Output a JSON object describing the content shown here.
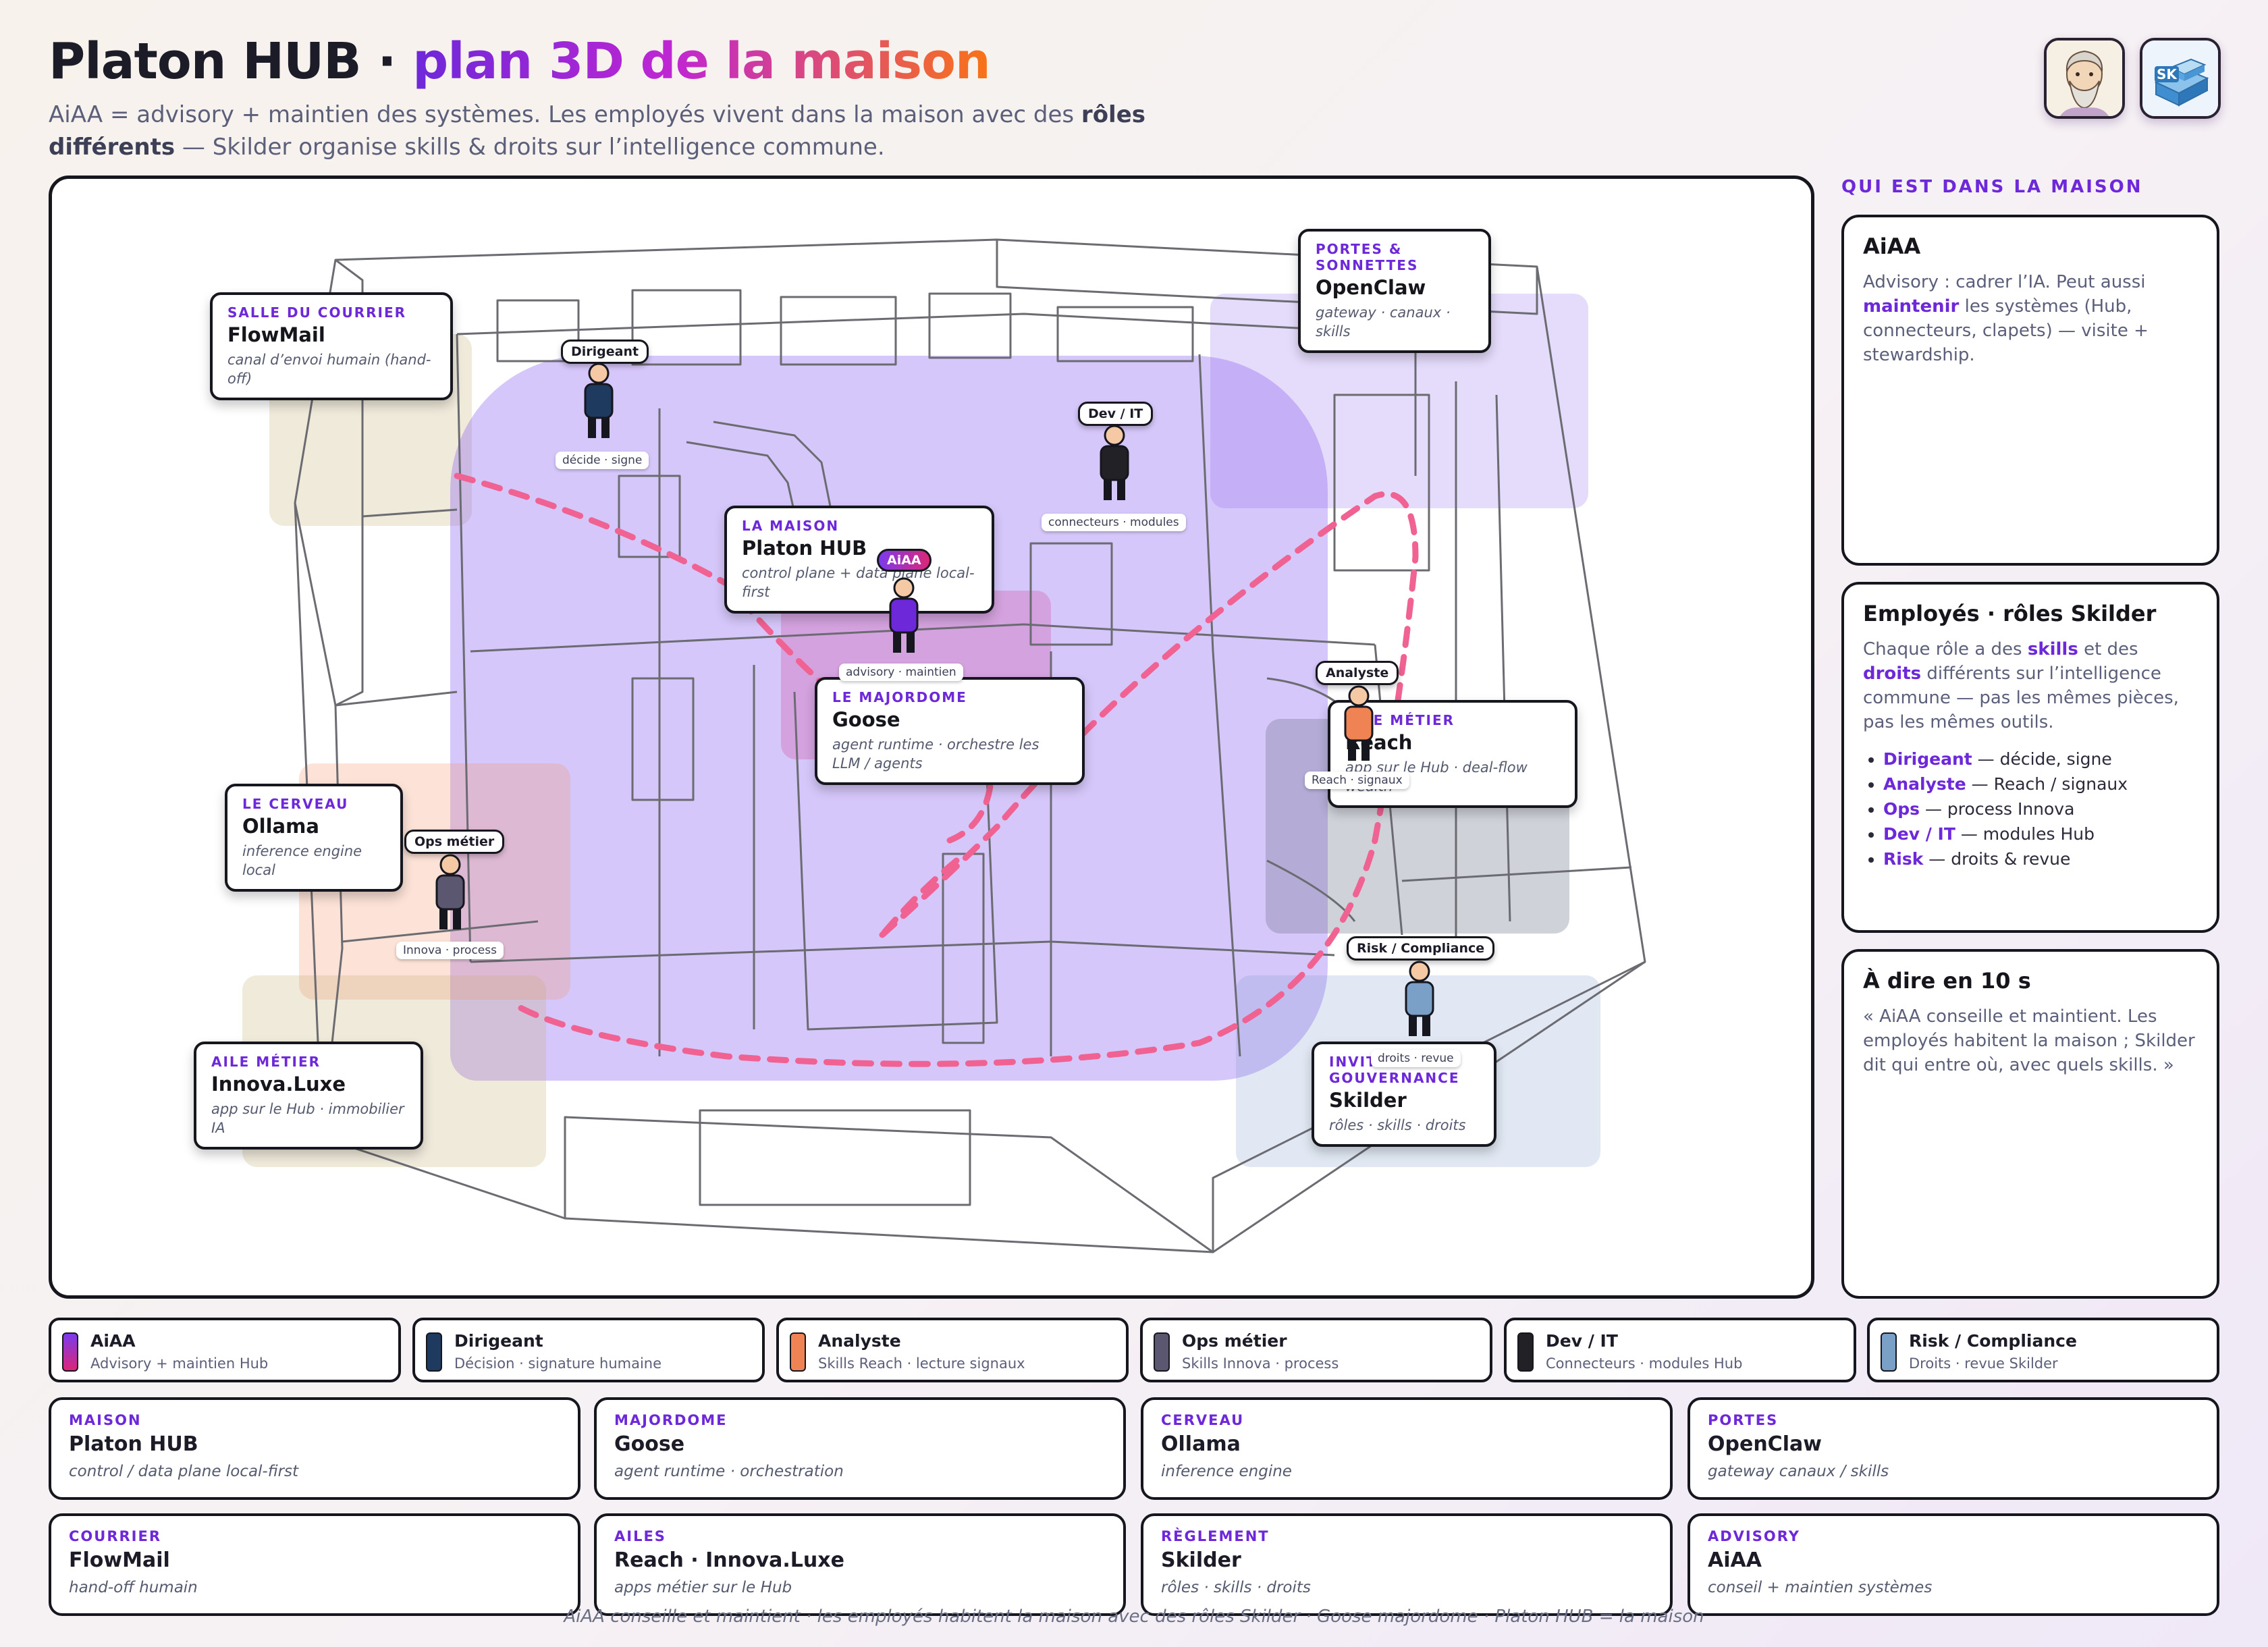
{
  "header": {
    "title_main": "Platon HUB · ",
    "title_accent": "plan 3D de la maison",
    "subtitle_a": "AiAA = advisory + maintien des systèmes. Les employés vivent dans la maison avec des ",
    "subtitle_bold": "rôles différents",
    "subtitle_b": " — Skilder organise skills & droits sur l’intelligence commune.",
    "avatar_right": "SK"
  },
  "plan": {
    "zones": [
      {
        "kicker": "SALLE DU COURRIER",
        "title": "FlowMail",
        "sub": "canal d’envoi humain (hand-off)"
      },
      {
        "kicker": "PORTES & SONNETTES",
        "title": "OpenClaw",
        "sub": "gateway · canaux · skills"
      },
      {
        "kicker": "LA MAISON",
        "title": "Platon HUB",
        "sub": "control plane + data plane local-first"
      },
      {
        "kicker": "LE MAJORDOME",
        "title": "Goose",
        "sub": "agent runtime · orchestre les LLM / agents"
      },
      {
        "kicker": "AILE MÉTIER",
        "title": "Reach",
        "sub": "app sur le Hub · deal-flow wealth"
      },
      {
        "kicker": "LE CERVEAU",
        "title": "Ollama",
        "sub": "inference engine local"
      },
      {
        "kicker": "AILE MÉTIER",
        "title": "Innova.Luxe",
        "sub": "app sur le Hub · immobilier IA"
      },
      {
        "kicker": "INVITÉ GOUVERNANCE",
        "title": "Skilder",
        "sub": "rôles · skills · droits"
      }
    ],
    "people": [
      {
        "role": "Dirigeant",
        "caption": "décide · signe",
        "color": "#1e3a5f"
      },
      {
        "role": "Dev / IT",
        "caption": "connecteurs · modules",
        "color": "#222226"
      },
      {
        "role": "AiAA",
        "caption": "advisory · maintien",
        "color": "#6d28d9"
      },
      {
        "role": "Analyste",
        "caption": "Reach · signaux",
        "color": "#ef8354"
      },
      {
        "role": "Ops métier",
        "caption": "Innova · process",
        "color": "#5b5770"
      },
      {
        "role": "Risk / Compliance",
        "caption": "droits · revue",
        "color": "#7aa0c8"
      }
    ]
  },
  "sidebar": {
    "heading": "QUI EST DANS LA MAISON",
    "aiaa": {
      "title": "AiAA",
      "a": "Advisory : cadrer l’IA. Peut aussi ",
      "b": "maintenir",
      "c": " les systèmes (Hub, connecteurs, clapets) — visite + stewardship."
    },
    "roles": {
      "title": "Employés · rôles Skilder",
      "a": "Chaque rôle a des ",
      "b": "skills",
      "c": " et des ",
      "d": "droits",
      "e": " différents sur l’intelligence commune — pas les mêmes pièces, pas les mêmes outils.",
      "items": [
        {
          "name": "Dirigeant",
          "desc": " — décide, signe"
        },
        {
          "name": "Analyste",
          "desc": " — Reach / signaux"
        },
        {
          "name": "Ops",
          "desc": " — process Innova"
        },
        {
          "name": "Dev / IT",
          "desc": " — modules Hub"
        },
        {
          "name": "Risk",
          "desc": " — droits & revue"
        }
      ]
    },
    "pitch": {
      "title": "À dire en 10 s",
      "body": "« AiAA conseille et maintient. Les employés habitent la maison ; Skilder dit qui entre où, avec quels skills. »"
    }
  },
  "legend": [
    {
      "title": "AiAA",
      "sub": "Advisory + maintien Hub",
      "color": "#7c3aed"
    },
    {
      "title": "Dirigeant",
      "sub": "Décision · signature humaine",
      "color": "#1e3a5f"
    },
    {
      "title": "Analyste",
      "sub": "Skills Reach · lecture signaux",
      "color": "#ef8354"
    },
    {
      "title": "Ops métier",
      "sub": "Skills Innova · process",
      "color": "#5b5770"
    },
    {
      "title": "Dev / IT",
      "sub": "Connecteurs · modules Hub",
      "color": "#222226"
    },
    {
      "title": "Risk / Compliance",
      "sub": "Droits · revue Skilder",
      "color": "#7aa0c8"
    }
  ],
  "cards": [
    {
      "kicker": "MAISON",
      "title": "Platon HUB",
      "sub": "control / data plane local-first"
    },
    {
      "kicker": "MAJORDOME",
      "title": "Goose",
      "sub": "agent runtime · orchestration"
    },
    {
      "kicker": "CERVEAU",
      "title": "Ollama",
      "sub": "inference engine"
    },
    {
      "kicker": "PORTES",
      "title": "OpenClaw",
      "sub": "gateway canaux / skills"
    },
    {
      "kicker": "COURRIER",
      "title": "FlowMail",
      "sub": "hand-off humain"
    },
    {
      "kicker": "AILES",
      "title": "Reach · Innova.Luxe",
      "sub": "apps métier sur le Hub"
    },
    {
      "kicker": "RÈGLEMENT",
      "title": "Skilder",
      "sub": "rôles · skills · droits"
    },
    {
      "kicker": "ADVISORY",
      "title": "AiAA",
      "sub": "conseil + maintien systèmes"
    }
  ],
  "footer": "AiAA conseille et maintient · les employés habitent la maison avec des rôles Skilder · Goose majordome · Platon HUB = la maison"
}
